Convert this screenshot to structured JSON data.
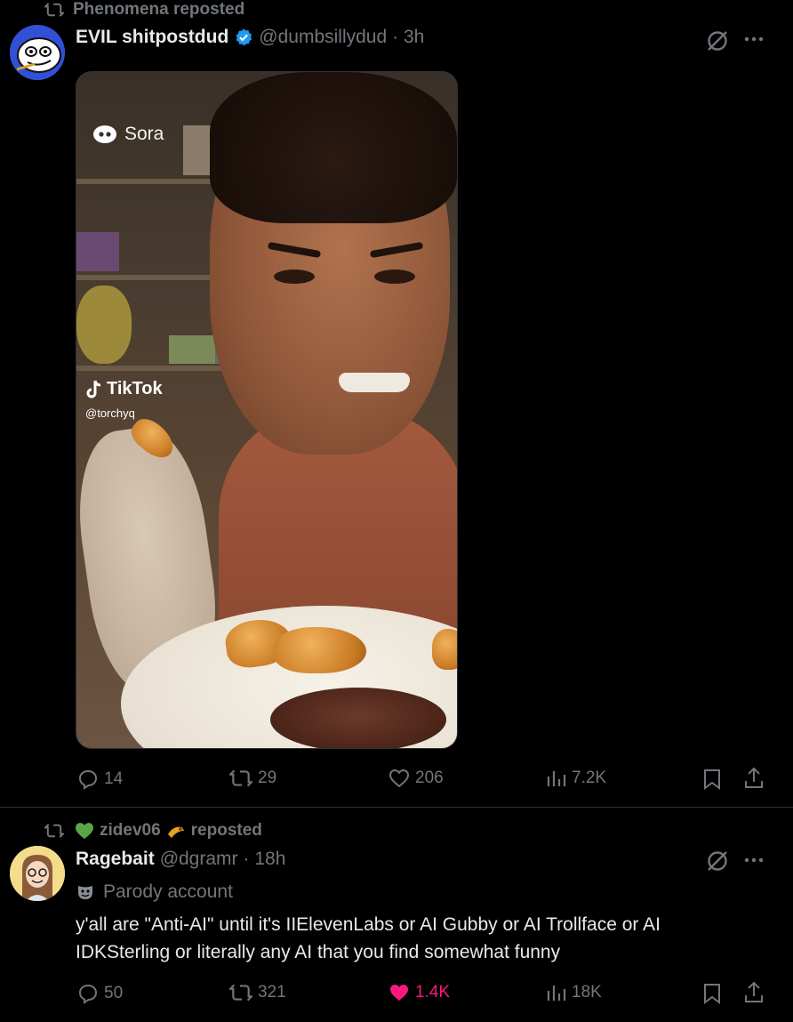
{
  "post1": {
    "repost_label": "Phenomena reposted",
    "author_name": "EVIL shitpostdud",
    "author_handle": "@dumbsillydud",
    "time": "· 3h",
    "media": {
      "watermark_sora": "Sora",
      "watermark_tiktok": "TikTok",
      "watermark_tiktok_handle": "@torchyq"
    },
    "actions": {
      "replies": "14",
      "reposts": "29",
      "likes": "206",
      "views": "7.2K"
    }
  },
  "post2": {
    "repost_label_user": "zidev06",
    "repost_label_suffix": "reposted",
    "author_name": "Ragebait",
    "author_handle": "@dgramr",
    "time": "· 18h",
    "parody_label": "Parody account",
    "text": "y'all are \"Anti-AI\" until it's IIElevenLabs or AI Gubby or AI Trollface or AI IDKSterling or literally any AI that you find somewhat funny",
    "actions": {
      "replies": "50",
      "reposts": "321",
      "likes": "1.4K",
      "views": "18K",
      "liked": true
    }
  },
  "colors": {
    "background": "#000000",
    "text": "#e7e9ea",
    "muted": "#71767b",
    "verified": "#1d9bf0",
    "like_active": "#f91880",
    "divider": "#2f3336"
  },
  "icons": [
    "repost-icon",
    "verified-badge-icon",
    "grok-icon",
    "more-icon",
    "reply-icon",
    "like-icon",
    "views-icon",
    "bookmark-icon",
    "share-icon",
    "heart-emoji-icon",
    "parody-mask-icon"
  ]
}
